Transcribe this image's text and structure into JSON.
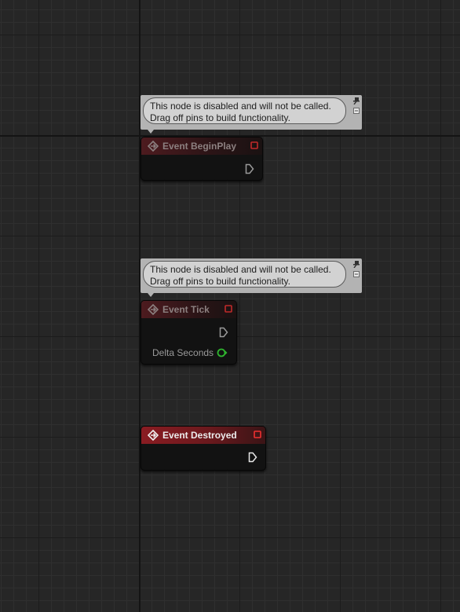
{
  "comments": {
    "begin_play": {
      "line1": "This node is disabled and will not be called.",
      "line2": "Drag off pins to build functionality."
    },
    "tick": {
      "line1": "This node is disabled and will not be called.",
      "line2": "Drag off pins to build functionality."
    }
  },
  "nodes": {
    "begin_play": {
      "title": "Event BeginPlay",
      "state": "disabled"
    },
    "tick": {
      "title": "Event Tick",
      "state": "disabled",
      "param_label": "Delta Seconds"
    },
    "destroyed": {
      "title": "Event Destroyed",
      "state": "enabled"
    }
  },
  "colors": {
    "header_enabled": "#8a1c22",
    "header_disabled": "#4d1b1f",
    "delegate_pin": "#e02b2b",
    "float_pin": "#3ad13a"
  }
}
